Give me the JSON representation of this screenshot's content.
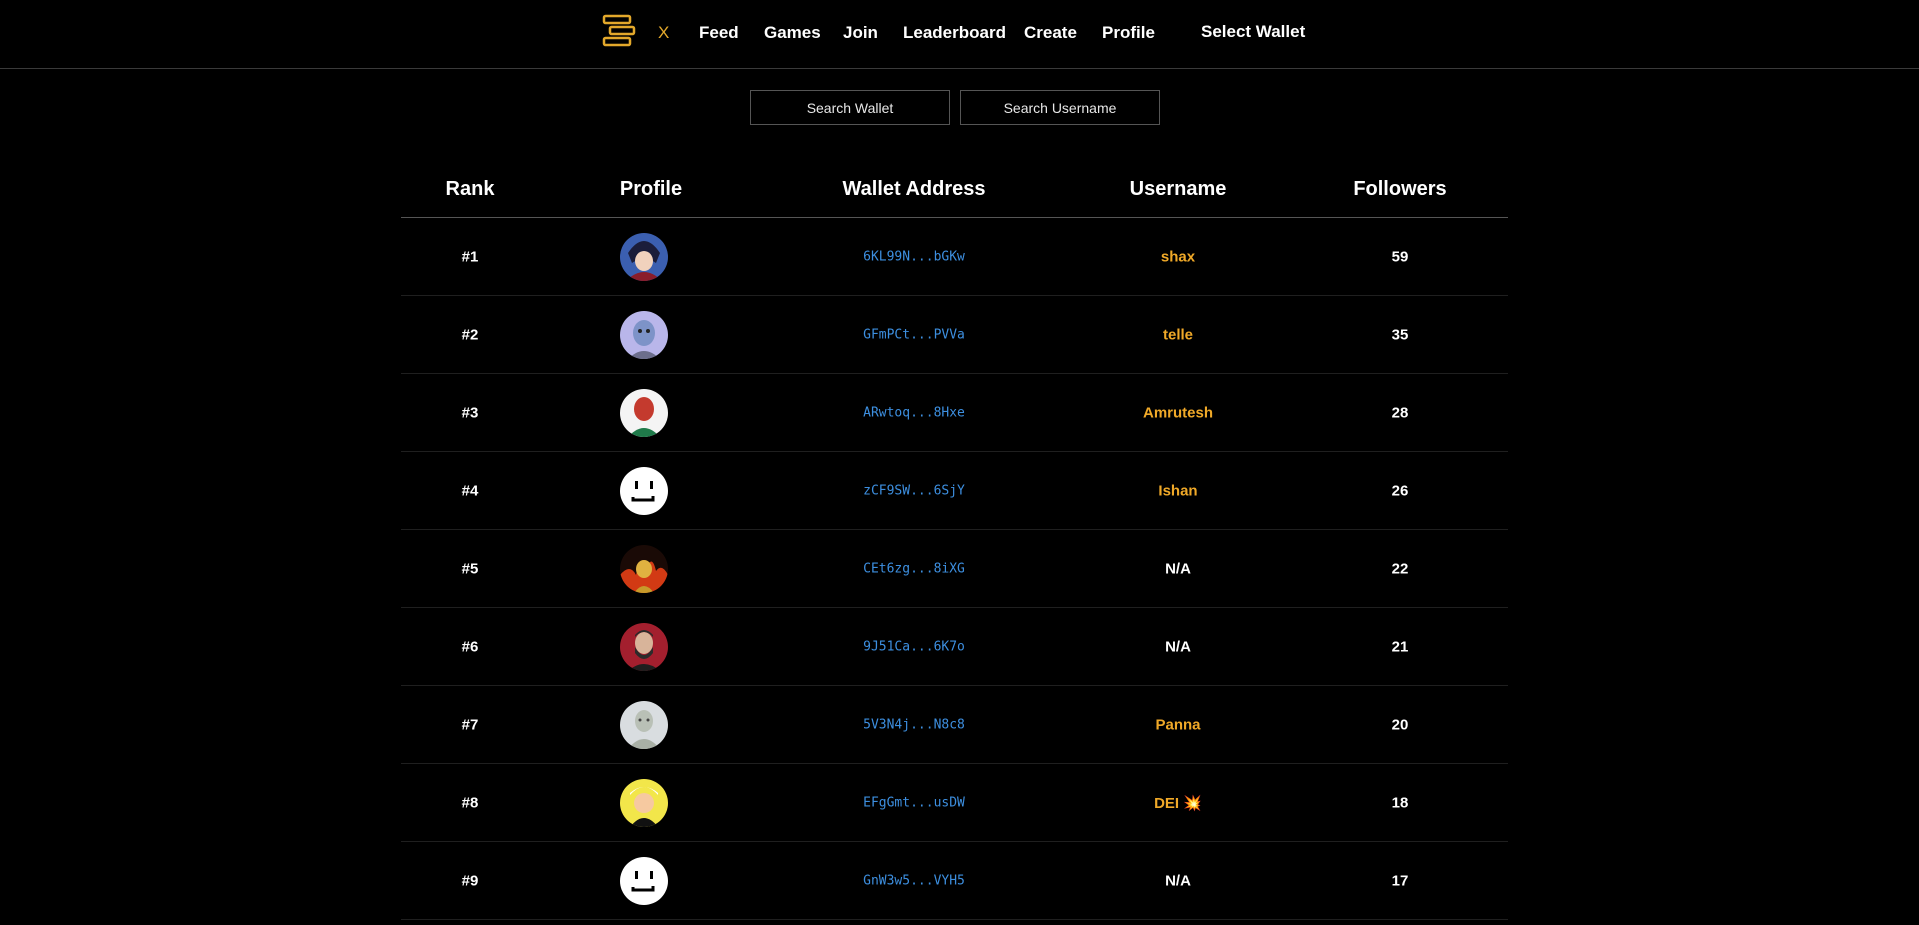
{
  "nav": {
    "x_label": "X",
    "links": [
      "Feed",
      "Games",
      "Join",
      "Leaderboard",
      "Create",
      "Profile"
    ],
    "select_wallet": "Select Wallet",
    "logo_color": "#e3a82b"
  },
  "search": {
    "wallet_placeholder": "Search Wallet",
    "username_placeholder": "Search Username"
  },
  "table": {
    "headers": [
      "Rank",
      "Profile",
      "Wallet Address",
      "Username",
      "Followers"
    ],
    "rows": [
      {
        "rank": "#1",
        "avatar": "anime-character-avatar",
        "wallet": "6KL99N...bGKw",
        "username": "shax",
        "followers": "59"
      },
      {
        "rank": "#2",
        "avatar": "alien-character-avatar",
        "wallet": "GFmPCt...PVVa",
        "username": "telle",
        "followers": "35"
      },
      {
        "rank": "#3",
        "avatar": "masked-character-avatar",
        "wallet": "ARwtoq...8Hxe",
        "username": "Amrutesh",
        "followers": "28"
      },
      {
        "rank": "#4",
        "avatar": "default-smiley-avatar",
        "wallet": "zCF9SW...6SjY",
        "username": "Ishan",
        "followers": "26"
      },
      {
        "rank": "#5",
        "avatar": "fire-character-avatar",
        "wallet": "CEt6zg...8iXG",
        "username": "N/A",
        "followers": "22"
      },
      {
        "rank": "#6",
        "avatar": "bearded-man-avatar",
        "wallet": "9J51Ca...6K7o",
        "username": "N/A",
        "followers": "21"
      },
      {
        "rank": "#7",
        "avatar": "statue-character-avatar",
        "wallet": "5V3N4j...N8c8",
        "username": "Panna",
        "followers": "20"
      },
      {
        "rank": "#8",
        "avatar": "yellow-character-avatar",
        "wallet": "EFgGmt...usDW",
        "username": "DEI 💥",
        "followers": "18"
      },
      {
        "rank": "#9",
        "avatar": "default-smiley-avatar",
        "wallet": "GnW3w5...VYH5",
        "username": "N/A",
        "followers": "17"
      }
    ]
  },
  "colors": {
    "accent": "#f0a928",
    "wallet_link": "#3d8fe0",
    "background": "#000000"
  }
}
